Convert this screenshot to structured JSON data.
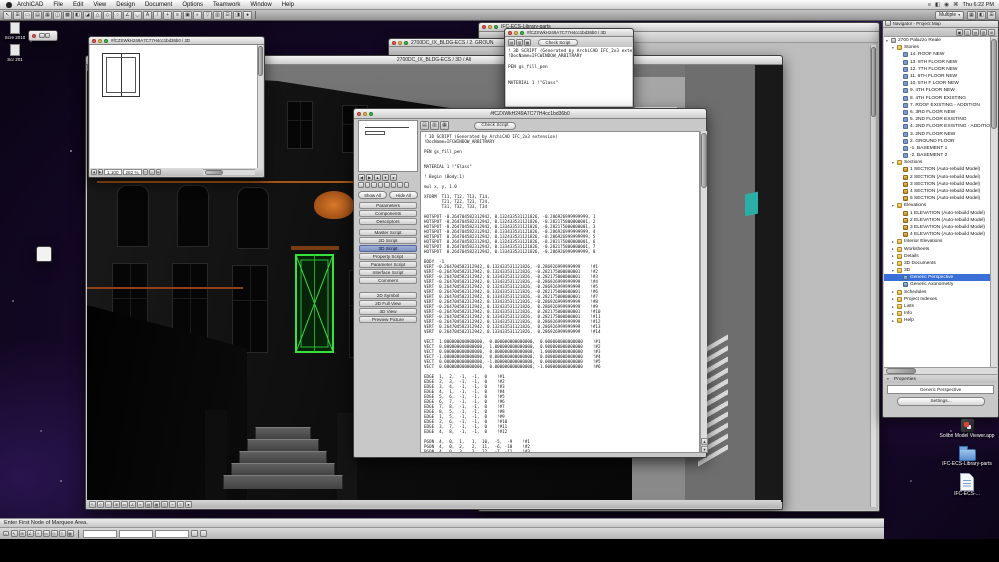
{
  "menubar": {
    "items": [
      "ArchiCAD",
      "File",
      "Edit",
      "View",
      "Design",
      "Document",
      "Options",
      "Teamwork",
      "Window",
      "Help"
    ],
    "status_icons": [
      "≡",
      "◧",
      "◉",
      "⌘"
    ],
    "clock": "Thu 6:22 PM"
  },
  "app_toolbar": {
    "icons": [
      "↖",
      "⊞",
      "▭",
      "▤",
      "▦",
      "◫",
      "▩",
      "◧",
      "◪",
      "△",
      "◇",
      "○",
      "∠",
      "◡",
      "A",
      "/",
      "+",
      "≡",
      "▣",
      "◐",
      "▽",
      "▥",
      "⊟",
      "◨",
      "●"
    ],
    "right_label": "Multiple",
    "right_icons": [
      "▦",
      "◧",
      "⊞"
    ]
  },
  "finder_window": {
    "title": "IFC-ECS-Library-parts"
  },
  "ground_window": {
    "title": "2700DC_IX_BLDG-ECS / 2. GROUN"
  },
  "script3d_window": {
    "title": "#fCZXWkH249A7C77H4cc1bd36b0 / 3D",
    "toolbar_icons": [
      "▤",
      "▥",
      "▦"
    ],
    "check_button": "Check Script",
    "lines": [
      "! 3D SCRIPT (Generated by ArchiCAD IFC_2x3 extension)",
      "!DocName=IFCWINDOW_ARBITRARY",
      "",
      "PEN gs_fill_pen",
      "",
      "",
      "MATERIAL 1 !\"Glass\""
    ]
  },
  "window_2d": {
    "title": "#fCZXWkH249A7C77H4cc1bd36b0 / 2D",
    "pager": [
      "◀",
      "▶"
    ],
    "scale": "1:100",
    "zoom": "282 %",
    "bottom_icons": [
      "▭",
      "◇",
      "⊞"
    ]
  },
  "main3d_window": {
    "title": "2700DC_IX_BLDG-ECS / 3D / All",
    "bottom_icons": [
      "↖",
      "◇",
      "○",
      "⊞",
      "▭",
      "∠",
      "◐",
      "▤",
      "▦",
      "◫",
      "+",
      "≡",
      "●"
    ]
  },
  "script_editor": {
    "title": "#fCZXWkH249A7C77H4cc1bd36b0",
    "toolbar_icons": [
      "▤",
      "▥",
      "▦"
    ],
    "check_button": "Check Script",
    "zoom_icons": [
      "◀",
      "▶",
      "▲",
      "▼",
      "●"
    ],
    "zoom_cells": [
      "",
      "",
      "",
      "",
      "",
      "",
      "",
      ""
    ],
    "show_all": "Show All",
    "hide_all": "Hide All",
    "sections": [
      {
        "label": "Parameters"
      },
      {
        "label": "Components"
      },
      {
        "label": "Descriptors"
      },
      {
        "label": "Master Script",
        "cls": "gap"
      },
      {
        "label": "2D Script"
      },
      {
        "label": "3D Script",
        "cls": "active"
      },
      {
        "label": "Property Script"
      },
      {
        "label": "Parameter Script"
      },
      {
        "label": "Interface Script"
      },
      {
        "label": "Comment"
      },
      {
        "label": "2D Symbol",
        "cls": "gap2"
      },
      {
        "label": "2D Full View"
      },
      {
        "label": "3D View"
      },
      {
        "label": "Preview Picture"
      }
    ],
    "script_lines": [
      "! 3D SCRIPT (Generated by ArchiCAD IFC_2x3 extension)",
      "!DocName=IFCWINDOW_ARBITRARY",
      "",
      "PEN gs_fill_pen",
      "",
      "",
      "MATERIAL 1 !\"Glass\"",
      "",
      "! Begin (Body:1)",
      "",
      "mul x, y, 1.0",
      "",
      "XFORM  T11, T12, T13, T14,",
      "       T21, T22, T23, T24,",
      "       T31, T32, T33, T34",
      "",
      "HOTSPOT -0.264704582312942, 0.132433531121826, -0.286926999999999, 1",
      "HOTSPOT -0.264704582312942, 0.132433531121826, -0.282175000000001, 2",
      "HOTSPOT -0.264704582312942, 0.133433531121826, -0.282175000000001, 3",
      "HOTSPOT -0.264704582312942, 0.133433531121826, -0.286926999999999, 4",
      "HOTSPOT  0.264704582312942, 0.132433531121826, -0.286926999999999, 5",
      "HOTSPOT  0.264704582312942, 0.132433531121826, -0.282175000000001, 6",
      "HOTSPOT  0.264704582312942, 0.133433531121826, -0.282175000000001, 7",
      "HOTSPOT  0.264704582312942, 0.133433531121826, -0.286926999999999, 8",
      "",
      "BODY  -1",
      "VERT -0.264704582312942, 0.132433531121826, -0.286926999999999    !#1",
      "VERT -0.264704582312942, 0.132433531121826, -0.282175000000001    !#2",
      "VERT -0.264704582312942, 0.133433531121826, -0.282175000000001    !#3",
      "VERT -0.264704582312942, 0.133433531121826, -0.286926999999999    !#4",
      "VERT  0.264704582312942, 0.132433531121826, -0.286926999999999    !#5",
      "VERT  0.264704582312942, 0.132433531121826, -0.282175000000001    !#6",
      "VERT  0.264704582312942, 0.133433531121826, -0.282175000000001    !#7",
      "VERT  0.264704582312942, 0.133433531121826, -0.286926999999999    !#8",
      "VERT -0.264704582312942, 0.132433531121826,  0.286926999999999    !#9",
      "VERT -0.264704582312942, 0.132433531121826,  0.282175000000001    !#10",
      "VERT -0.264704582312942, 0.133433531121826,  0.282175000000001    !#11",
      "VERT -0.264704582312942, 0.133433531121826,  0.286926999999999    !#12",
      "VERT  0.264704582312942, 0.132433531121826,  0.286926999999999    !#13",
      "VERT  0.264704582312942, 0.133433531121826,  0.286926999999999    !#14",
      "",
      "VECT  1.000000000000000,  0.000000000000000,  0.000000000000000    !#1",
      "VECT  0.000000000000000,  1.000000000000000,  0.000000000000000    !#2",
      "VECT  0.000000000000000,  0.000000000000000,  1.000000000000000    !#3",
      "VECT -1.000000000000000,  0.000000000000000,  0.000000000000000    !#4",
      "VECT  0.000000000000000, -1.000000000000000,  0.000000000000000    !#5",
      "VECT  0.000000000000000,  0.000000000000000, -1.000000000000000    !#6",
      "",
      "EDGE  1,  2,  -1,  -1,  0    !#1",
      "EDGE  2,  3,  -1,  -1,  0    !#2",
      "EDGE  3,  4,  -1,  -1,  0    !#3",
      "EDGE  4,  1,  -1,  -1,  0    !#4",
      "EDGE  5,  6,  -1,  -1,  0    !#5",
      "EDGE  6,  7,  -1,  -1,  0    !#6",
      "EDGE  7,  8,  -1,  -1,  0    !#7",
      "EDGE  8,  5,  -1,  -1,  0    !#8",
      "EDGE  1,  5,  -1,  -1,  0    !#9",
      "EDGE  2,  6,  -1,  -1,  0    !#10",
      "EDGE  3,  7,  -1,  -1,  0    !#11",
      "EDGE  4,  8,  -1,  -1,  0    !#12",
      "",
      "PGON  4,  0,  1,   1,  10,  -5,  -9    !#1",
      "PGON  4,  0,  2,   2,  11,  -6, -10    !#2",
      "PGON  4,  0,  3,   3,  12,  -7, -11    !#3"
    ]
  },
  "navigator": {
    "title": "Navigator - Project Map",
    "toolbar_icons": [
      "▣",
      "◫",
      "▤",
      "▥",
      "⊞"
    ],
    "tree": [
      {
        "label": "2700 Palazzo Reale",
        "indent": 0,
        "cls": "grp root",
        "tri": "▾"
      },
      {
        "label": "Stories",
        "indent": 1,
        "cls": "grp",
        "tri": "▾"
      },
      {
        "label": "14. ROOF NEW",
        "indent": 2,
        "cls": "story"
      },
      {
        "label": "13. 8TH FLOOR NEW",
        "indent": 2,
        "cls": "story"
      },
      {
        "label": "12. 7TH FLOOR NEW",
        "indent": 2,
        "cls": "story"
      },
      {
        "label": "11. 6TH FLOOR NEW",
        "indent": 2,
        "cls": "story"
      },
      {
        "label": "10. 5TH F LOOR NEW",
        "indent": 2,
        "cls": "story"
      },
      {
        "label": "9. 4TH FLOOR NEW",
        "indent": 2,
        "cls": "story"
      },
      {
        "label": "8. 4TH FLOOR EXISTING",
        "indent": 2,
        "cls": "story"
      },
      {
        "label": "7. ROOF EXISTING - ADDITION",
        "indent": 2,
        "cls": "story"
      },
      {
        "label": "6. 3RD FLOOR NEW",
        "indent": 2,
        "cls": "story"
      },
      {
        "label": "5. 2ND FLOOR EXISTING",
        "indent": 2,
        "cls": "story"
      },
      {
        "label": "4. 2ND FLOOR EXISTING - ADDITION",
        "indent": 2,
        "cls": "story"
      },
      {
        "label": "3. 2ND FLOOR NEW",
        "indent": 2,
        "cls": "story"
      },
      {
        "label": "2. GROUND FLOOR",
        "indent": 2,
        "cls": "story"
      },
      {
        "label": "-1. BASEMENT 1",
        "indent": 2,
        "cls": "story"
      },
      {
        "label": "-2. BASEMENT 2",
        "indent": 2,
        "cls": "story"
      },
      {
        "label": "Sections",
        "indent": 1,
        "cls": "grp",
        "tri": "▾"
      },
      {
        "label": "1 SECTION (Auto-rebuild Model)",
        "indent": 2,
        "cls": "sec"
      },
      {
        "label": "2 SECTION (Auto-rebuild Model)",
        "indent": 2,
        "cls": "sec"
      },
      {
        "label": "3 SECTION (Auto-rebuild Model)",
        "indent": 2,
        "cls": "sec"
      },
      {
        "label": "4 SECTION (Auto-rebuild Model)",
        "indent": 2,
        "cls": "sec"
      },
      {
        "label": "5 SECTION (Auto-rebuild Model)",
        "indent": 2,
        "cls": "sec"
      },
      {
        "label": "Elevations",
        "indent": 1,
        "cls": "grp",
        "tri": "▾"
      },
      {
        "label": "1 ELEVATION (Auto-rebuild Model)",
        "indent": 2,
        "cls": "sec"
      },
      {
        "label": "2 ELEVATION (Auto-rebuild Model)",
        "indent": 2,
        "cls": "sec"
      },
      {
        "label": "3 ELEVATION (Auto-rebuild Model)",
        "indent": 2,
        "cls": "sec"
      },
      {
        "label": "4 ELEVATION (Auto-rebuild Model)",
        "indent": 2,
        "cls": "sec"
      },
      {
        "label": "Interior Elevations",
        "indent": 1,
        "cls": "grp",
        "tri": "▸"
      },
      {
        "label": "Worksheets",
        "indent": 1,
        "cls": "grp",
        "tri": "▸"
      },
      {
        "label": "Details",
        "indent": 1,
        "cls": "grp",
        "tri": "▸"
      },
      {
        "label": "3D Documents",
        "indent": 1,
        "cls": "grp",
        "tri": "▸"
      },
      {
        "label": "3D",
        "indent": 1,
        "cls": "grp",
        "tri": "▾"
      },
      {
        "label": "Generic Perspective",
        "indent": 2,
        "cls": "view sel"
      },
      {
        "label": "Generic Axonometry",
        "indent": 2,
        "cls": "view"
      },
      {
        "label": "Schedules",
        "indent": 1,
        "cls": "grp",
        "tri": "▸"
      },
      {
        "label": "Project Indexes",
        "indent": 1,
        "cls": "grp",
        "tri": "▸"
      },
      {
        "label": "Lists",
        "indent": 1,
        "cls": "grp",
        "tri": "▸"
      },
      {
        "label": "Info",
        "indent": 1,
        "cls": "grp",
        "tri": "▸"
      },
      {
        "label": "Help",
        "indent": 1,
        "cls": "grp",
        "tri": "▸"
      }
    ],
    "properties_label": "Properties",
    "properties_tri": "▾",
    "view_name": "Generic Perspective",
    "settings_button": "Settings..."
  },
  "statusbar": {
    "message": "Enter First Node of Marquee Area."
  },
  "coordbar": {
    "close": "×",
    "icons": [
      "↖",
      "⊞",
      "∠",
      "+",
      "▭",
      "◇",
      "≡",
      "▦"
    ]
  },
  "desktop_icons": {
    "left": [
      {
        "label": "Scre 2010",
        "cls": "file"
      },
      {
        "label": "Scr 201",
        "cls": "file"
      }
    ],
    "right": [
      {
        "label": "Solibri Model Viewer.app",
        "cls": "app"
      },
      {
        "label": "IFC-ECS-Library-parts",
        "cls": "folder"
      },
      {
        "label": "IFC-ECS-...",
        "cls": "doc"
      }
    ]
  }
}
